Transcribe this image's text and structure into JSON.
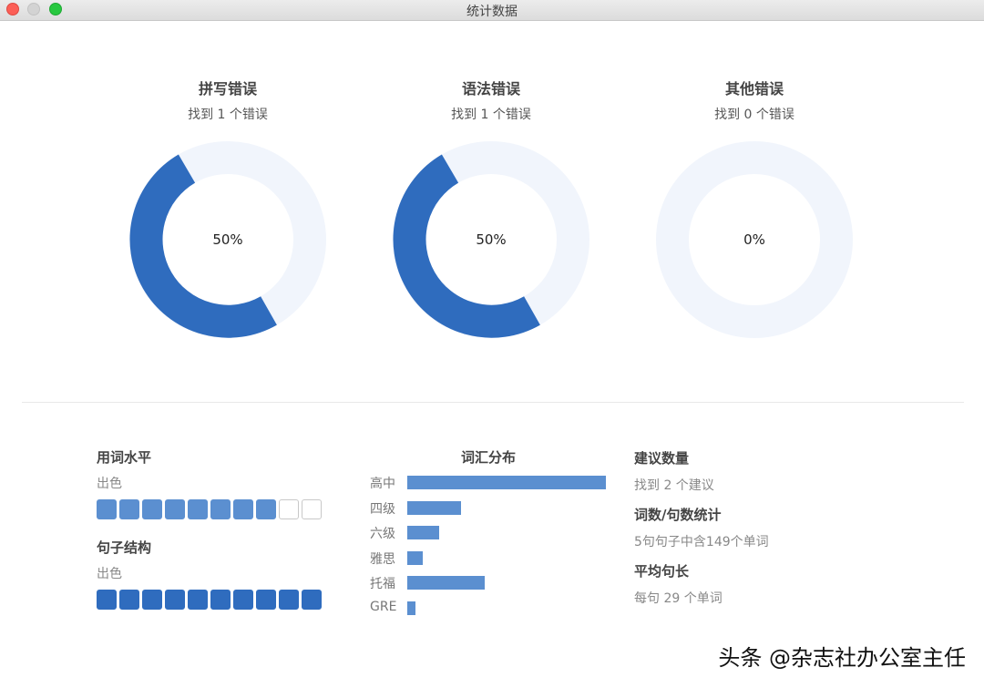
{
  "window": {
    "title": "统计数据"
  },
  "errors": [
    {
      "title": "拼写错误",
      "subtitle": "找到 1 个错误",
      "percent_label": "50%",
      "percent": 50
    },
    {
      "title": "语法错误",
      "subtitle": "找到 1 个错误",
      "percent_label": "50%",
      "percent": 50
    },
    {
      "title": "其他错误",
      "subtitle": "找到 0 个错误",
      "percent_label": "0%",
      "percent": 0
    }
  ],
  "vocabulary_level": {
    "title": "用词水平",
    "rating": "出色",
    "filled": 8,
    "total": 10
  },
  "sentence_structure": {
    "title": "句子结构",
    "rating": "出色",
    "filled": 10,
    "total": 10
  },
  "vocab_distribution": {
    "title": "词汇分布",
    "items": [
      {
        "label": "高中",
        "value": 100
      },
      {
        "label": "四级",
        "value": 27
      },
      {
        "label": "六级",
        "value": 16
      },
      {
        "label": "雅思",
        "value": 8
      },
      {
        "label": "托福",
        "value": 39
      },
      {
        "label": "GRE",
        "value": 4
      }
    ]
  },
  "stats": {
    "suggestions": {
      "title": "建议数量",
      "value": "找到 2 个建议"
    },
    "word_sentence": {
      "title": "词数/句数统计",
      "value": "5句句子中含149个单词"
    },
    "avg_length": {
      "title": "平均句长",
      "value": "每句 29 个单词"
    }
  },
  "colors": {
    "accent": "#2f6cbe",
    "accent_light": "#5b8fd0",
    "track": "#f1f5fc"
  },
  "watermark": "头条 @杂志社办公室主任"
}
